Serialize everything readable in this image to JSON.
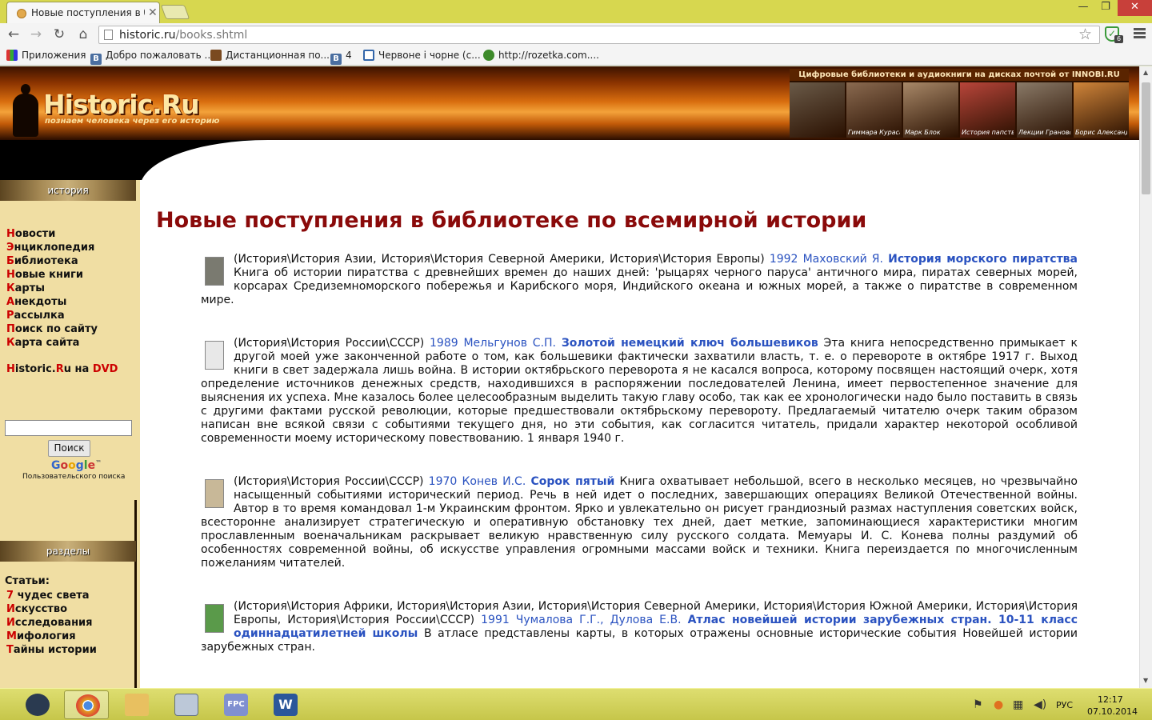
{
  "browser": {
    "tab_title": "Новые поступления в биб",
    "url_host": "historic.ru",
    "url_path": "/books.shtml",
    "ext_badge": "6",
    "bookmarks": [
      {
        "label": "Приложения",
        "icon": "apps-icon"
      },
      {
        "label": "Добро пожаловать ...",
        "icon": "vk-icon",
        "glyph": "В"
      },
      {
        "label": "Дистанционная по...",
        "icon": "distance-learning-icon"
      },
      {
        "label": "4",
        "icon": "vk-icon",
        "glyph": "В"
      },
      {
        "label": "Червоне і чорне (с...",
        "icon": "book-icon"
      },
      {
        "label": "http://rozetka.com....",
        "icon": "rozetka-icon"
      }
    ]
  },
  "site": {
    "logo": "Historic.Ru",
    "tagline": "познаем человека через его историю",
    "promo_title": "Цифровые библиотеки и аудиокниги на дисках почтой от INNOBI.RU",
    "promo_covers": [
      {
        "label": "",
        "color": "#6a5a48"
      },
      {
        "label": "Гиммара Кураса",
        "color": "#8a6a50"
      },
      {
        "label": "Марк Блок",
        "color": "#a88868"
      },
      {
        "label": "История папства",
        "color": "#b8453a"
      },
      {
        "label": "Лекции Грановского",
        "color": "#8a7a68"
      },
      {
        "label": "Борис Александрович Тураев",
        "color": "#d0853a"
      }
    ]
  },
  "sidebar": {
    "section1_title": "история",
    "nav": [
      {
        "first": "Н",
        "rest": "овости"
      },
      {
        "first": "Э",
        "rest": "нциклопедия"
      },
      {
        "first": "Б",
        "rest": "иблиотека"
      },
      {
        "first": "Н",
        "rest": "овые книги"
      },
      {
        "first": "К",
        "rest": "арты"
      },
      {
        "first": "А",
        "rest": "некдоты"
      },
      {
        "first": "Р",
        "rest": "ассылка"
      },
      {
        "first": "П",
        "rest": "оиск по сайту"
      },
      {
        "first": "К",
        "rest": "арта сайта"
      }
    ],
    "dvd": {
      "h": "H",
      "mid1": "istoric.",
      "r": "R",
      "mid2": "u на ",
      "dvd": "DVD"
    },
    "search_placeholder": "",
    "search_button": "Поиск",
    "google_sub": "Пользовательского поиска",
    "google_tm": "™",
    "section2_title": "разделы",
    "articles_label": "Статьи:",
    "sections": [
      {
        "first": "7",
        "rest": " чудес света"
      },
      {
        "first": "И",
        "rest": "скусство"
      },
      {
        "first": "И",
        "rest": "сследования"
      },
      {
        "first": "М",
        "rest": "ифология"
      },
      {
        "first": "Т",
        "rest": "айны истории"
      }
    ]
  },
  "main": {
    "page_title": "Новые поступления в библиотеке по всемирной истории",
    "entries": [
      {
        "cats": "(История\\История Азии, История\\История Северной Америки, История\\История Европы) ",
        "meta": "1992 Маховский Я. ",
        "title": "История морского пиратства",
        "desc": " Книга об истории пиратства с древнейших времен до наших дней: 'рыцарях черного паруса' античного мира, пиратах северных морей, корсарах Средиземноморского побережья и Карибского моря, Индийского океана и южных морей, а также о пиратстве в современном мире.",
        "thumb_color": "#7a7a70"
      },
      {
        "cats": "(История\\История России\\СССР) ",
        "meta": "1989 Мельгунов С.П. ",
        "title": "Золотой немецкий ключ большевиков",
        "desc": " Эта книга непосредственно примыкает к другой моей уже законченной работе о том, как большевики фактически захватили власть, т. е. о перевороте в октябре 1917 г. Выход книги в свет задержала лишь война. В истории октябрьского переворота я не касался вопроса, которому посвящен настоящий очерк, хотя определение источников денежных средств, находившихся в распоряжении последователей Ленина, имеет первостепенное значение для выяснения их успеха. Мне казалось более целесообразным выделить такую главу особо, так как ее хронологически надо было поставить в связь с другими фактами русской революции, которые предшествовали октябрьскому перевороту. Предлагаемый читателю очерк таким образом написан вне всякой связи с событиями текущего дня, но эти события, как согласится читатель, придали характер некоторой особливой современности моему историческому повествованию. 1 января 1940 г.",
        "thumb_color": "#e8e8e8"
      },
      {
        "cats": "(История\\История России\\СССР) ",
        "meta": "1970 Конев И.С. ",
        "title": "Сорок пятый",
        "desc": " Книга охватывает небольшой, всего в несколько месяцев, но чрезвычайно насыщенный событиями исторический период. Речь в ней идет о последних, завершающих операциях Великой Отечественной войны. Автор в то время командовал 1-м Украинским фронтом. Ярко и увлекательно он рисует грандиозный размах наступления советских войск, всесторонне анализирует стратегическую и оперативную обстановку тех дней, дает меткие, запоминающиеся характеристики многим прославленным военачальникам раскрывает великую нравственную силу русского солдата. Мемуары И. С. Конева полны раздумий об особенностях современной войны, об искусстве управления огромными массами войск и техники. Книга переиздается по многочисленным пожеланиям читателей.",
        "thumb_color": "#c8b898"
      },
      {
        "cats": "(История\\История Африки, История\\История Азии, История\\История Северной Америки, История\\История Южной Америки, История\\История Европы, История\\История России\\СССР) ",
        "meta": "1991 Чумалова Г.Г., Дулова Е.В. ",
        "title": "Атлас новейшей истории зарубежных стран. 10-11 класс одиннадцатилетней школы",
        "desc": " В атласе представлены карты, в которых отражены основные исторические события Новейшей истории зарубежных стран.",
        "thumb_color": "#5a9a4a"
      }
    ]
  },
  "taskbar": {
    "apps": [
      "steam-app",
      "chrome-app",
      "file-explorer-app",
      "calculator-app",
      "fpc-app",
      "word-app"
    ],
    "fpc_label": "FPC",
    "word_label": "W",
    "lang": "РУС",
    "time": "12:17",
    "date": "07.10.2014"
  }
}
